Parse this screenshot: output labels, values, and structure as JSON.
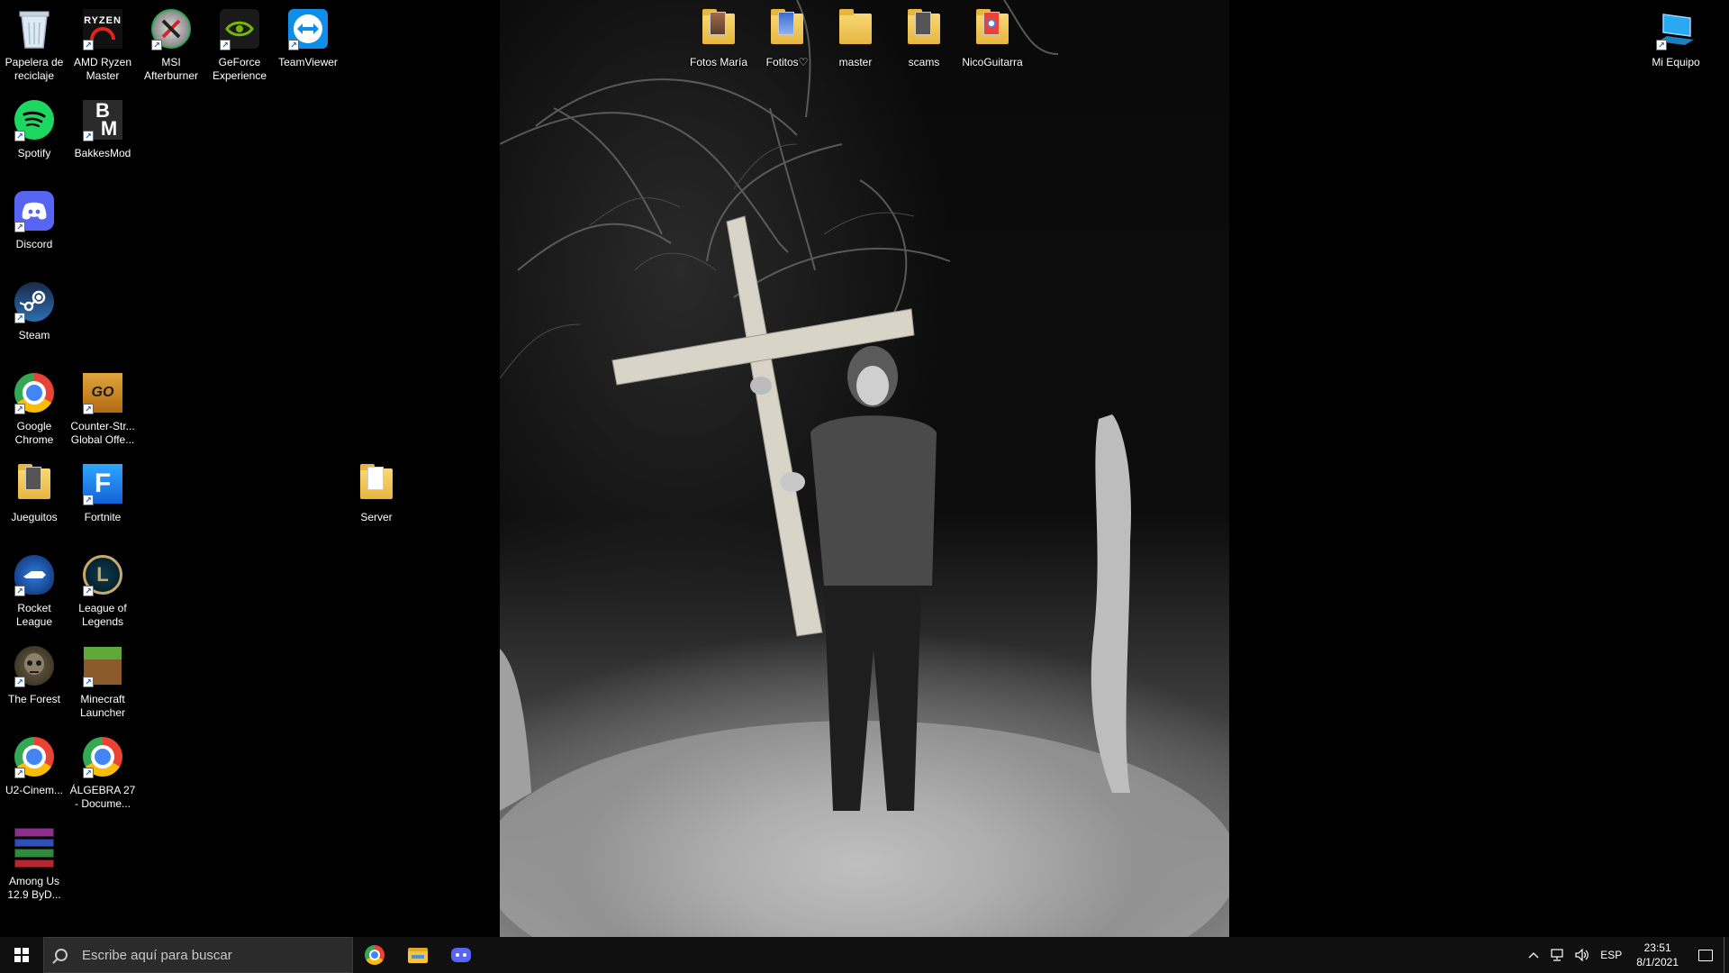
{
  "desktop": {
    "left_icons": [
      {
        "label": "Papelera de reciclaje",
        "icon": "recycle-bin-icon",
        "shortcut": false
      },
      {
        "label": "AMD Ryzen Master",
        "icon": "amd-ryzen-icon",
        "shortcut": true
      },
      {
        "label": "MSI Afterburner",
        "icon": "msi-afterburner-icon",
        "shortcut": true
      },
      {
        "label": "GeForce Experience",
        "icon": "nvidia-icon",
        "shortcut": true
      },
      {
        "label": "TeamViewer",
        "icon": "teamviewer-icon",
        "shortcut": true
      },
      {
        "label": "Spotify",
        "icon": "spotify-icon",
        "shortcut": true
      },
      {
        "label": "BakkesMod",
        "icon": "bakkesmod-icon",
        "shortcut": true
      },
      {
        "label": "Discord",
        "icon": "discord-icon",
        "shortcut": true
      },
      {
        "label": "Steam",
        "icon": "steam-icon",
        "shortcut": true
      },
      {
        "label": "Google Chrome",
        "icon": "chrome-icon",
        "shortcut": true
      },
      {
        "label": "Counter-Str... Global Offe...",
        "icon": "csgo-icon",
        "shortcut": true
      },
      {
        "label": "Jueguitos",
        "icon": "folder-icon",
        "shortcut": false
      },
      {
        "label": "Fortnite",
        "icon": "fortnite-icon",
        "shortcut": true
      },
      {
        "label": "Server",
        "icon": "folder-icon",
        "shortcut": false
      },
      {
        "label": "Rocket League",
        "icon": "rocket-league-icon",
        "shortcut": true
      },
      {
        "label": "League of Legends",
        "icon": "league-icon",
        "shortcut": true
      },
      {
        "label": "The Forest",
        "icon": "the-forest-icon",
        "shortcut": true
      },
      {
        "label": "Minecraft Launcher",
        "icon": "minecraft-icon",
        "shortcut": true
      },
      {
        "label": "U2-Cinem...",
        "icon": "chrome-icon",
        "shortcut": true
      },
      {
        "label": "ÁLGEBRA 27 - Docume...",
        "icon": "chrome-icon",
        "shortcut": true
      },
      {
        "label": "Among Us 12.9 ByD...",
        "icon": "winrar-icon",
        "shortcut": false
      }
    ],
    "top_icons": [
      {
        "label": "Fotos María",
        "icon": "folder-icon"
      },
      {
        "label": "Fotitos♡",
        "icon": "folder-icon"
      },
      {
        "label": "master",
        "icon": "folder-icon"
      },
      {
        "label": "scams",
        "icon": "folder-icon"
      },
      {
        "label": "NicoGuitarra",
        "icon": "folder-icon"
      }
    ],
    "right_icons": [
      {
        "label": "Mi Equipo",
        "icon": "computer-icon",
        "shortcut": true
      }
    ]
  },
  "taskbar": {
    "search_placeholder": "Escribe aquí para buscar",
    "pinned": [
      "chrome-icon",
      "file-explorer-icon",
      "discord-icon"
    ],
    "tray": {
      "language": "ESP",
      "time": "23:51",
      "date": "8/1/2021"
    }
  }
}
